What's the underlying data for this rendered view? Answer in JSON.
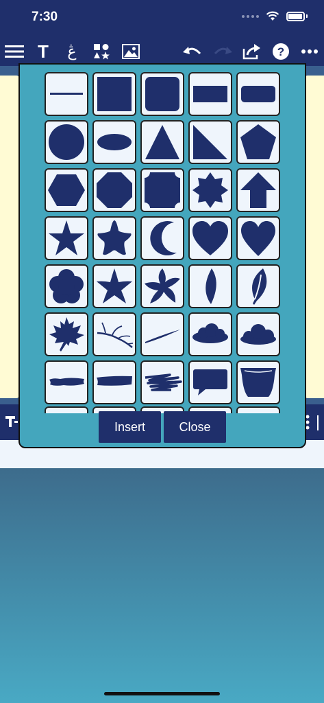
{
  "status_bar": {
    "time": "7:30"
  },
  "toolbar": {
    "icons": [
      "menu-icon",
      "text-icon",
      "arabic-text-icon",
      "shapes-icon",
      "image-icon",
      "undo-icon",
      "redo-icon",
      "share-icon",
      "help-icon",
      "more-icon"
    ],
    "text_glyph": "T",
    "arabic_glyph": "ڠ",
    "help_glyph": "?"
  },
  "shapes": {
    "rows": [
      [
        "line",
        "square",
        "rounded-square",
        "rectangle",
        "rounded-rectangle"
      ],
      [
        "circle",
        "ellipse",
        "triangle",
        "right-triangle",
        "pentagon"
      ],
      [
        "hexagon",
        "octagon",
        "notched-square",
        "eight-point-star",
        "arrow-up"
      ],
      [
        "five-point-star",
        "rounded-star",
        "crescent-moon",
        "heart",
        "heart-alt"
      ],
      [
        "flower",
        "sharp-star",
        "pinwheel-star",
        "leaf",
        "veined-leaf"
      ],
      [
        "maple-leaf",
        "branch",
        "curved-stroke",
        "cloud",
        "cloud-puffy"
      ],
      [
        "brush-stroke",
        "brush-stroke-thick",
        "scribble",
        "speech-bubble",
        "bucket"
      ]
    ]
  },
  "buttons": {
    "insert": "Insert",
    "close": "Close"
  },
  "colors": {
    "navy": "#1f2f6b",
    "teal": "#44a6bd",
    "tile": "#eff5fc",
    "cream": "#fffbd4"
  }
}
